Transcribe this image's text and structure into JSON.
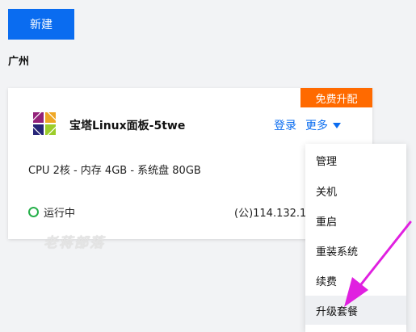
{
  "toolbar": {
    "new_label": "新建"
  },
  "region": {
    "label": "广州"
  },
  "instance": {
    "promo_label": "免费升配",
    "name": "宝塔Linux面板-5twe",
    "login_label": "登录",
    "more_label": "更多",
    "spec": "CPU 2核 - 内存 4GB - 系统盘 80GB",
    "status": "运行中",
    "ip": "(公)114.132.1"
  },
  "watermark": {
    "text": "老蒋部落"
  },
  "more_menu": {
    "items": [
      {
        "label": "管理"
      },
      {
        "label": "关机"
      },
      {
        "label": "重启"
      },
      {
        "label": "重装系统"
      },
      {
        "label": "续费"
      },
      {
        "label": "升级套餐"
      }
    ]
  },
  "colors": {
    "primary": "#0a6cf0",
    "promo": "#ff6a00",
    "running": "#27b04b",
    "annotation_arrow": "#e020e0"
  }
}
